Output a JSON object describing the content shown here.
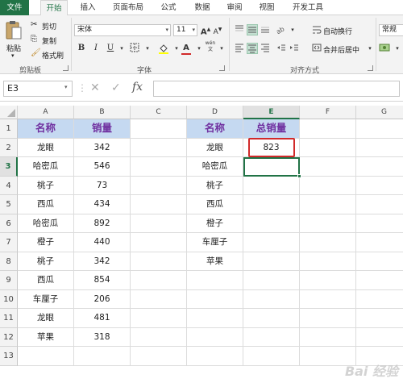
{
  "tabs": [
    "文件",
    "开始",
    "插入",
    "页面布局",
    "公式",
    "数据",
    "审阅",
    "视图",
    "开发工具"
  ],
  "clipboard": {
    "paste": "粘贴",
    "cut": "剪切",
    "copy": "复制",
    "format_painter": "格式刷",
    "group_label": "剪贴板"
  },
  "font": {
    "name": "宋体",
    "size": "11",
    "bold": "B",
    "italic": "I",
    "underline": "U",
    "grow": "A",
    "shrink": "A",
    "wen": "wén",
    "group_label": "字体"
  },
  "alignment": {
    "wrap_text": "自动换行",
    "merge_center": "合并后居中",
    "group_label": "对齐方式"
  },
  "number": {
    "format": "常规"
  },
  "formula_bar": {
    "name_box": "E3",
    "cancel": "✕",
    "enter": "✓",
    "fx": "fx",
    "value": ""
  },
  "columns": [
    "A",
    "B",
    "C",
    "D",
    "E",
    "F",
    "G"
  ],
  "rows": [
    "1",
    "2",
    "3",
    "4",
    "5",
    "6",
    "7",
    "8",
    "9",
    "10",
    "11",
    "12",
    "13"
  ],
  "table1": {
    "header": [
      "名称",
      "销量"
    ],
    "rows": [
      [
        "龙眼",
        "342"
      ],
      [
        "哈密瓜",
        "546"
      ],
      [
        "桃子",
        "73"
      ],
      [
        "西瓜",
        "434"
      ],
      [
        "哈密瓜",
        "892"
      ],
      [
        "橙子",
        "440"
      ],
      [
        "桃子",
        "342"
      ],
      [
        "西瓜",
        "854"
      ],
      [
        "车厘子",
        "206"
      ],
      [
        "龙眼",
        "481"
      ],
      [
        "苹果",
        "318"
      ]
    ]
  },
  "table2": {
    "header": [
      "名称",
      "总销量"
    ],
    "names": [
      "龙眼",
      "哈密瓜",
      "桃子",
      "西瓜",
      "橙子",
      "车厘子",
      "苹果"
    ],
    "totals": [
      "823"
    ]
  },
  "selected_cell": "E3",
  "colors": {
    "excel_green": "#217346",
    "header_fill": "#c5d9f1",
    "header_text": "#7030a0",
    "highlight": "#d12a2a"
  }
}
